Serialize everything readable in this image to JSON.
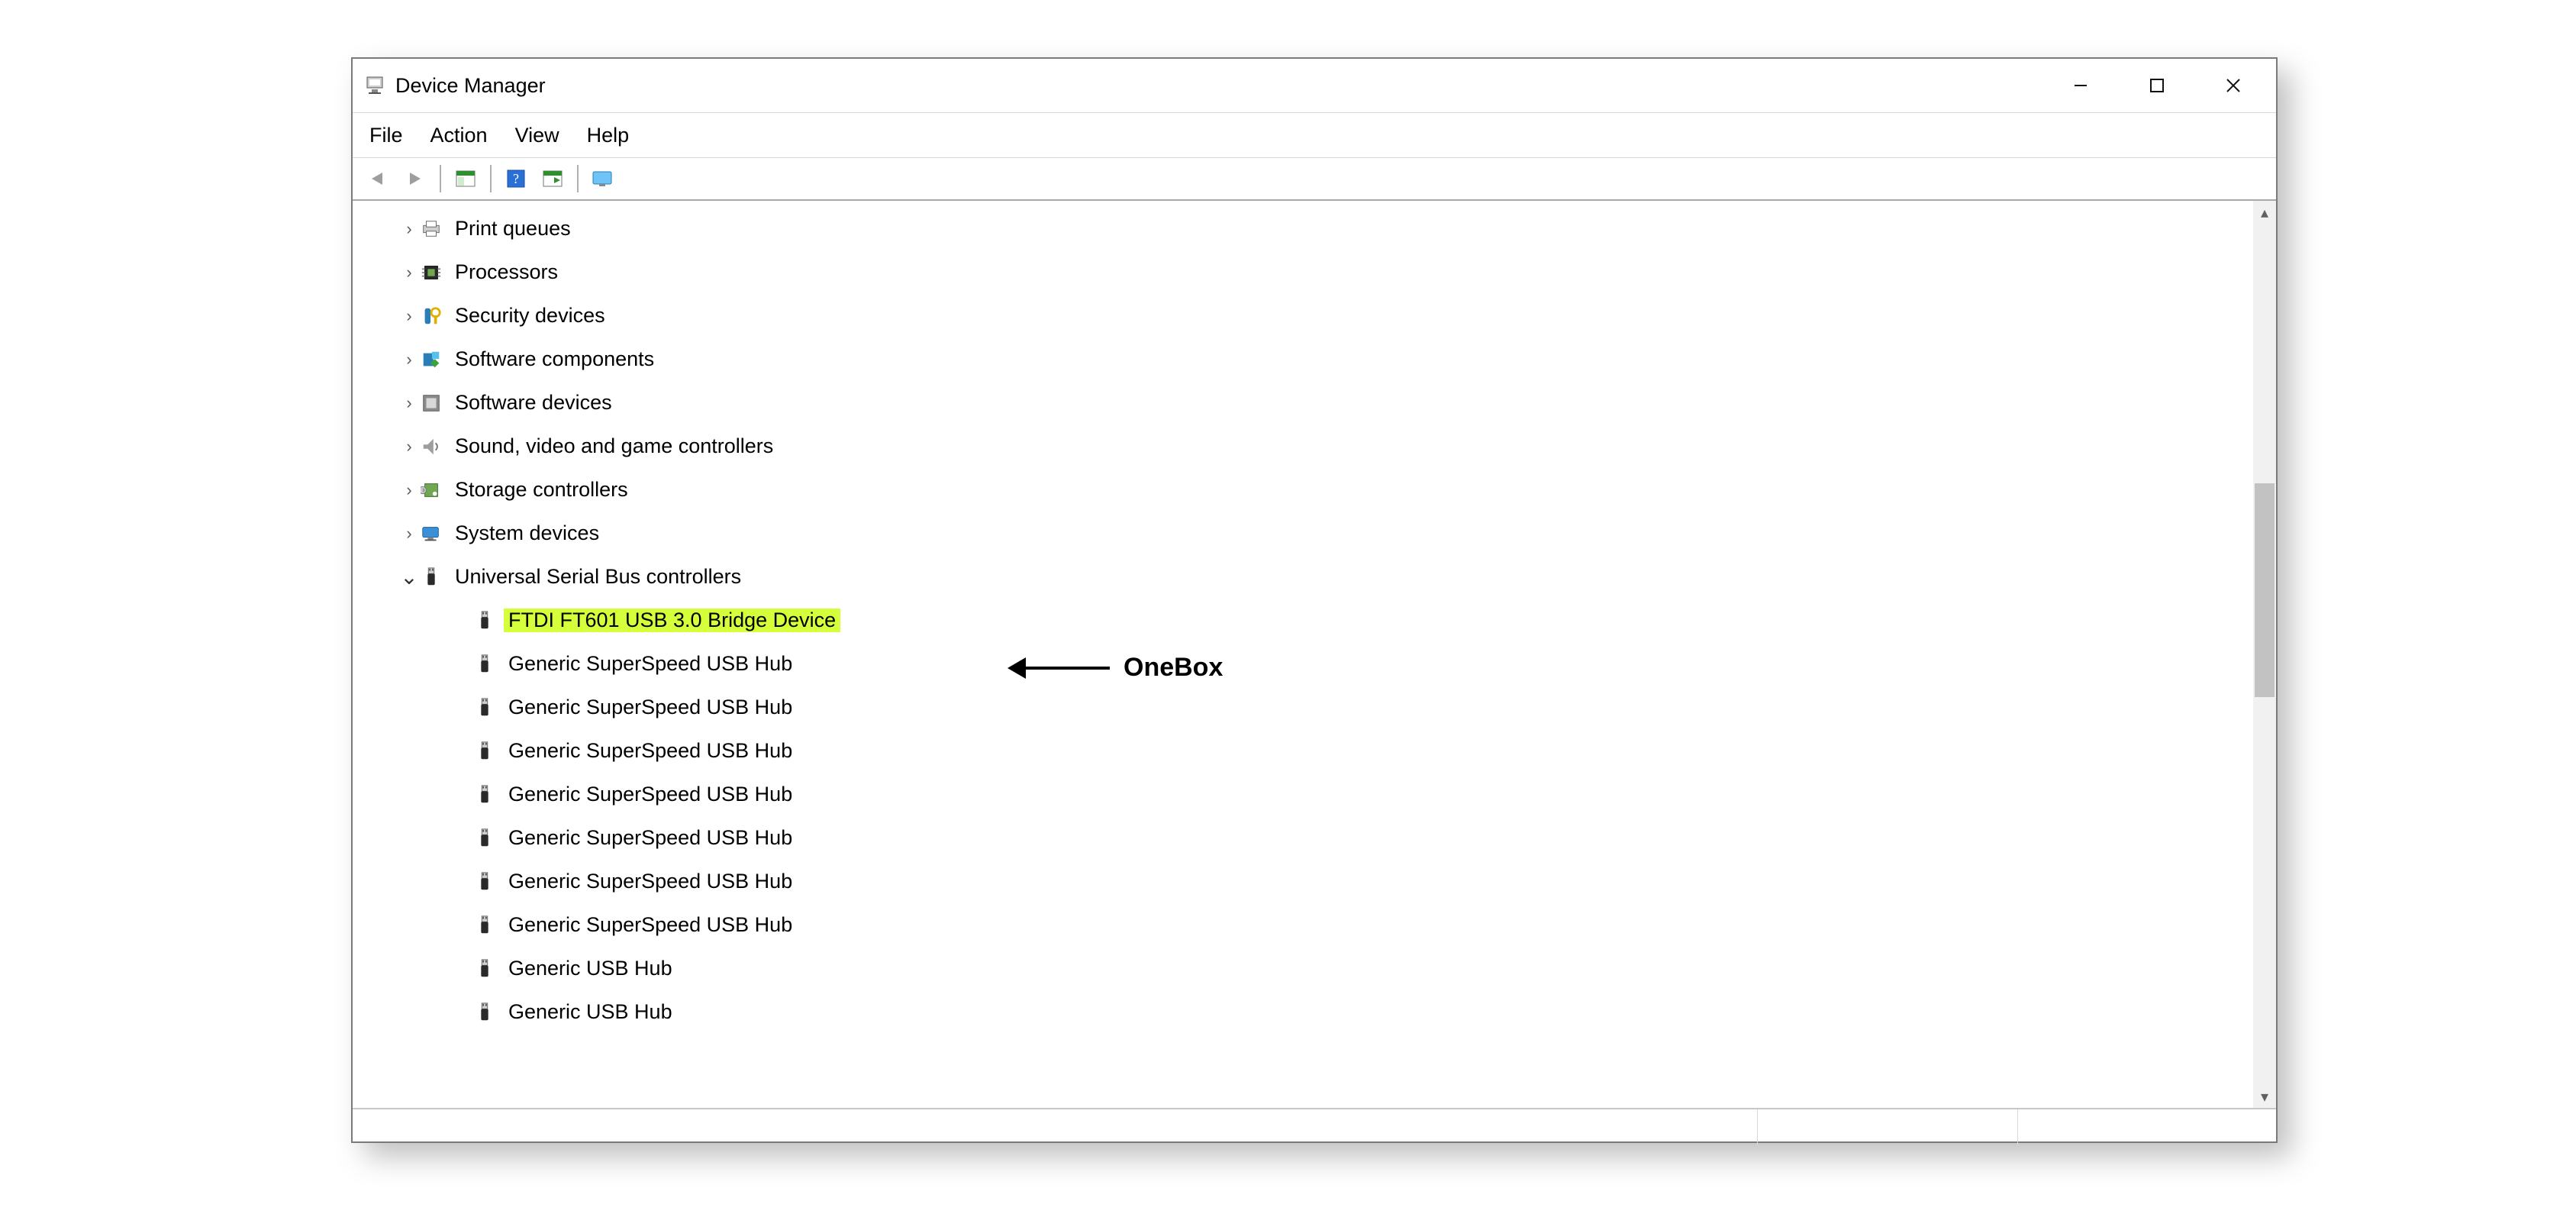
{
  "window": {
    "title": "Device Manager",
    "controls": {
      "minimize": "minimize",
      "maximize": "maximize",
      "close": "close"
    }
  },
  "menu": {
    "file": "File",
    "action": "Action",
    "view": "View",
    "help": "Help"
  },
  "toolbar": {
    "back": "back",
    "forward": "forward",
    "show_hidden": "show-hidden",
    "help": "help",
    "scan": "scan",
    "monitor": "monitor"
  },
  "annotation": {
    "label": "OneBox"
  },
  "tree": {
    "categories": [
      {
        "label": "Print queues",
        "icon": "printer",
        "expanded": false
      },
      {
        "label": "Processors",
        "icon": "cpu",
        "expanded": false
      },
      {
        "label": "Security devices",
        "icon": "key",
        "expanded": false
      },
      {
        "label": "Software components",
        "icon": "component",
        "expanded": false
      },
      {
        "label": "Software devices",
        "icon": "software",
        "expanded": false
      },
      {
        "label": "Sound, video and game controllers",
        "icon": "speaker",
        "expanded": false
      },
      {
        "label": "Storage controllers",
        "icon": "storage",
        "expanded": false
      },
      {
        "label": "System devices",
        "icon": "system",
        "expanded": false
      },
      {
        "label": "Universal Serial Bus controllers",
        "icon": "usb",
        "expanded": true
      }
    ],
    "usb_children": [
      {
        "label": "FTDI FT601 USB 3.0 Bridge Device",
        "highlighted": true
      },
      {
        "label": "Generic SuperSpeed USB Hub"
      },
      {
        "label": "Generic SuperSpeed USB Hub"
      },
      {
        "label": "Generic SuperSpeed USB Hub"
      },
      {
        "label": "Generic SuperSpeed USB Hub"
      },
      {
        "label": "Generic SuperSpeed USB Hub"
      },
      {
        "label": "Generic SuperSpeed USB Hub"
      },
      {
        "label": "Generic SuperSpeed USB Hub"
      },
      {
        "label": "Generic USB Hub"
      },
      {
        "label": "Generic USB Hub"
      }
    ]
  }
}
